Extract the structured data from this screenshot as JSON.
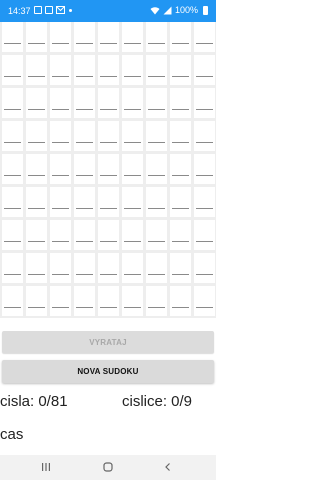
{
  "status_bar": {
    "time": "14:37",
    "battery": "100%",
    "icons": [
      "image-icon",
      "notification-icon",
      "mail-icon",
      "dot-icon",
      "wifi-icon",
      "signal-icon",
      "battery-icon"
    ]
  },
  "grid": {
    "rows": 9,
    "cols": 9,
    "cell_values": []
  },
  "buttons": {
    "calculate": "VYRATAJ",
    "new_sudoku": "NOVA SUDOKU"
  },
  "counters": {
    "numbers": "cisla: 0/81",
    "digits": "cislice: 0/9"
  },
  "time_label": "cas",
  "nav": {
    "icons": [
      "recent-apps-icon",
      "home-icon",
      "back-icon"
    ]
  },
  "colors": {
    "status_bar": "#2196f3",
    "grid_background": "#eeeeee",
    "button_background": "#dadada"
  }
}
